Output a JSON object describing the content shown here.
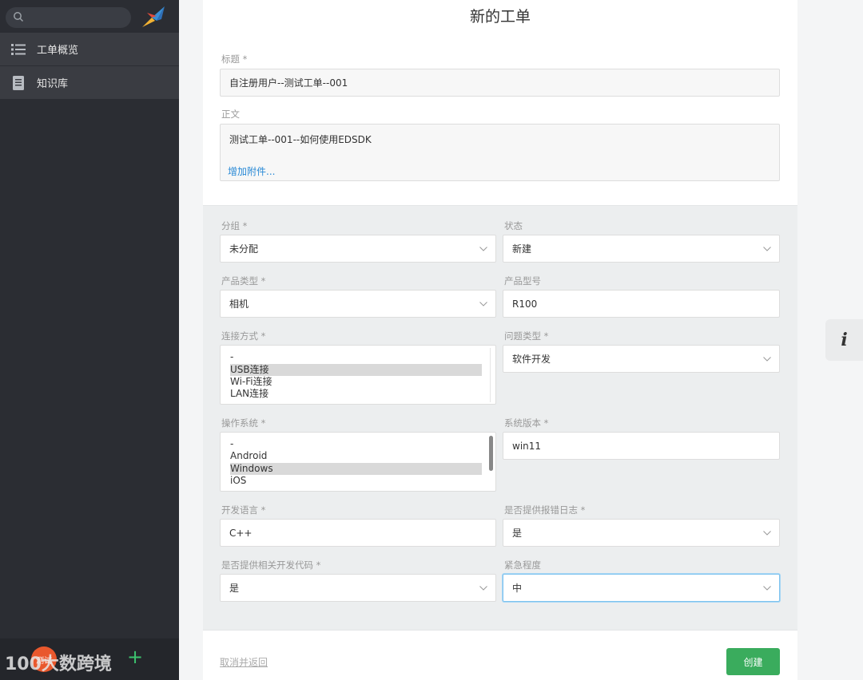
{
  "sidebar": {
    "search_placeholder": "",
    "items": [
      {
        "label": "工单概览",
        "icon": "list-icon"
      },
      {
        "label": "知识库",
        "icon": "book-icon"
      }
    ],
    "footer": {
      "avatar_text": "测试",
      "watermark": "100大数跨境",
      "add_label": "+"
    }
  },
  "form": {
    "title": "新的工单",
    "subject_label": "标题 *",
    "subject_value": "自注册用户--测试工单--001",
    "body_label": "正文",
    "body_value": "测试工单--001--如何使用EDSDK",
    "attach_label": "增加附件...",
    "group_label": "分组 *",
    "group_value": "未分配",
    "state_label": "状态",
    "state_value": "新建",
    "product_type_label": "产品类型 *",
    "product_type_value": "相机",
    "product_model_label": "产品型号",
    "product_model_value": "R100",
    "connection_label": "连接方式 *",
    "connection_options": [
      "-",
      "USB连接",
      "Wi-Fi连接",
      "LAN连接"
    ],
    "issue_type_label": "问题类型 *",
    "issue_type_value": "软件开发",
    "os_label": "操作系统 *",
    "os_options": [
      "-",
      "Android",
      "Windows",
      "iOS"
    ],
    "os_version_label": "系统版本 *",
    "os_version_value": "win11",
    "dev_lang_label": "开发语言 *",
    "dev_lang_value": "C++",
    "error_log_label": "是否提供报错日志 *",
    "error_log_value": "是",
    "dev_code_label": "是否提供相关开发代码 *",
    "dev_code_value": "是",
    "urgency_label": "紧急程度",
    "urgency_value": "中",
    "cancel_label": "取消并返回",
    "create_label": "创建"
  },
  "info_tab_label": "i",
  "colors": {
    "sidebar_bg": "#2b2d33",
    "accent_green": "#3aac5d",
    "link_blue": "#2a8ad6",
    "avatar_orange": "#e9582d"
  }
}
